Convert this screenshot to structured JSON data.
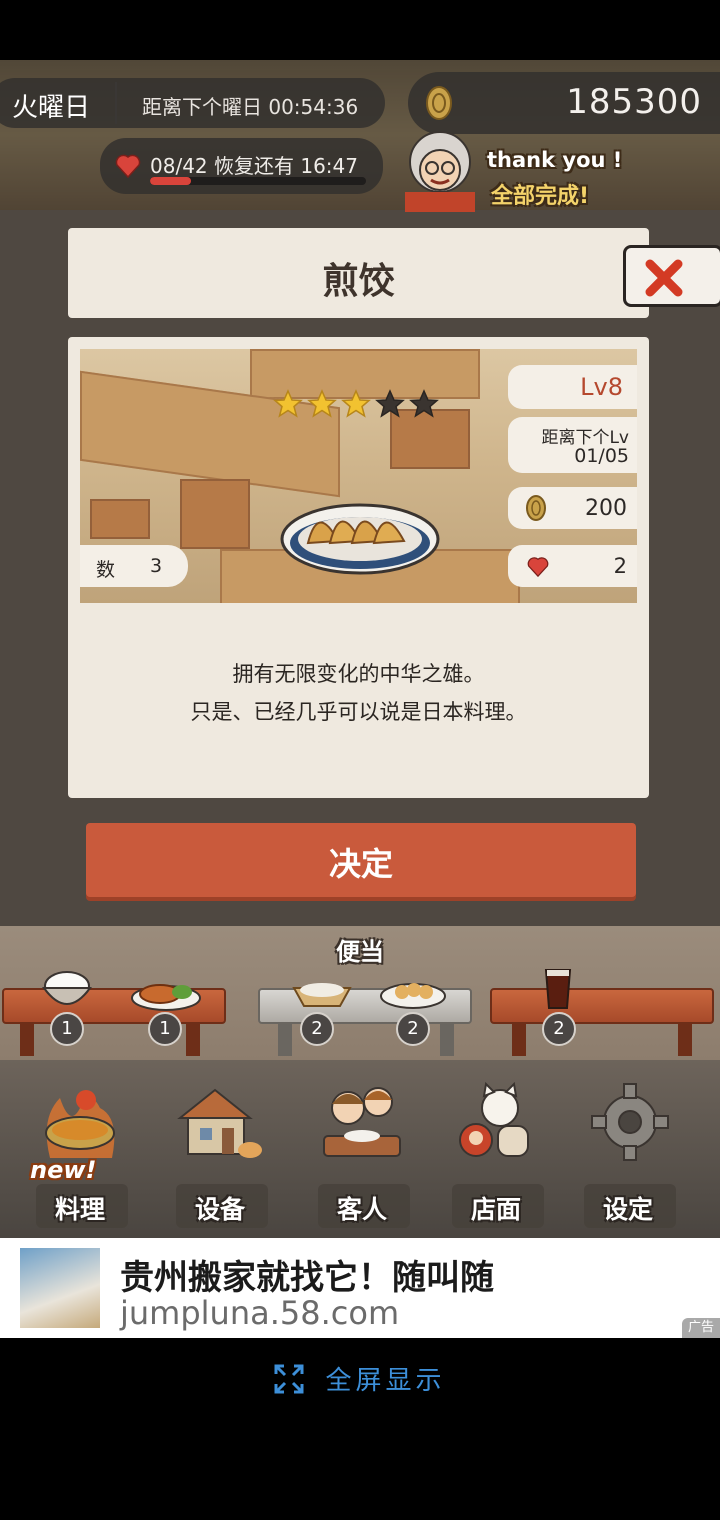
{
  "status_bar": {
    "day": "火曜日",
    "countdown": "距离下个曜日 00:54:36",
    "money": "185300",
    "hp_text": "08/42  恢复还有  16:47",
    "hp_fraction": 0.19
  },
  "banner": {
    "thanks": "thank  you !",
    "done": "全部完成!"
  },
  "dialog": {
    "title": "煎饺",
    "stars_filled": 3,
    "stars_total": 5,
    "level": "Lv8",
    "next_label": "距离下个Lv",
    "next_value": "01/05",
    "price": "200",
    "hearts": "2",
    "count_label": "数",
    "count_value": "3",
    "desc_line1": "拥有无限变化的中华之雄。",
    "desc_line2": "只是、已经几乎可以说是日本料理。",
    "confirm": "决定"
  },
  "bento": {
    "label": "便当",
    "items": [
      {
        "icon": "rice-bowl-icon",
        "count": "1"
      },
      {
        "icon": "tonkatsu-icon",
        "count": "1"
      },
      {
        "icon": "fried-rice-icon",
        "count": "2"
      },
      {
        "icon": "gyoza-icon",
        "count": "2"
      },
      {
        "icon": "cola-icon",
        "count": "2"
      }
    ]
  },
  "nav": {
    "new_badge": "new!",
    "items": [
      "料理",
      "设备",
      "客人",
      "店面",
      "设定"
    ]
  },
  "ad": {
    "title": "贵州搬家就找它！随叫随",
    "url": "jumpluna.58.com",
    "tag": "广告"
  },
  "fullscreen": "全屏显示",
  "colors": {
    "accent": "#c95a3c",
    "level_text": "#b5482e",
    "panel": "#efe9df",
    "link_blue": "#3d8fd9"
  }
}
